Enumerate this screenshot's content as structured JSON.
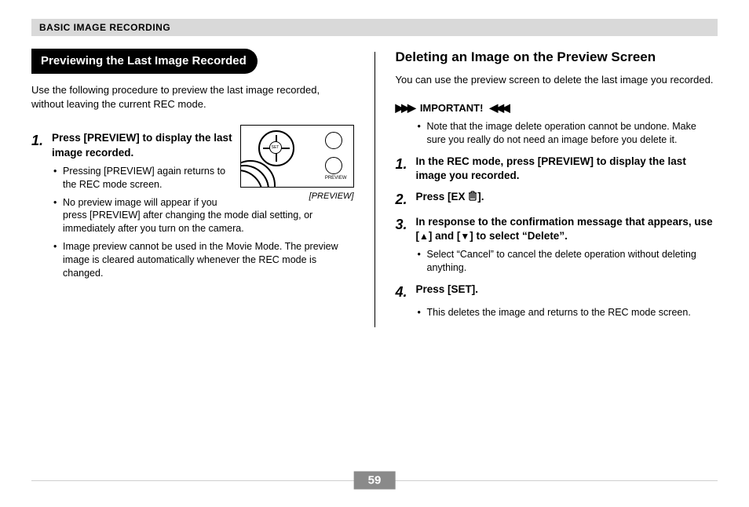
{
  "header": "BASIC IMAGE RECORDING",
  "page_number": "59",
  "left": {
    "pill": "Previewing the Last Image Recorded",
    "intro": "Use the following procedure to preview the last image recorded, without leaving the current REC mode.",
    "fig_caption": "[PREVIEW]",
    "fig_set_label": "SET",
    "fig_preview_label": "PREVIEW",
    "step1_num": "1.",
    "step1_text": "Press [PREVIEW] to display the last image recorded.",
    "step1_bullets": [
      "Pressing [PREVIEW] again returns to the REC mode screen.",
      "No preview image will appear if you press [PREVIEW] after changing the mode dial setting, or immediately after you turn on the camera.",
      "Image preview cannot be used in the Movie Mode. The preview image is cleared automatically whenever the REC mode is changed."
    ]
  },
  "right": {
    "title": "Deleting an Image on the Preview Screen",
    "intro": "You can use the preview screen to delete the last image you recorded.",
    "important_label": "IMPORTANT!",
    "important_bullets": [
      "Note that the image delete operation cannot be undone. Make sure you really do not need an image before you delete it."
    ],
    "steps": [
      {
        "num": "1.",
        "text": "In the REC mode, press [PREVIEW] to display the last image you recorded."
      },
      {
        "num": "2.",
        "pre": "Press [EX ",
        "post": "]."
      },
      {
        "num": "3.",
        "pre": "In response to the confirmation message that appears, use [",
        "mid": "] and [",
        "post": "] to select “Delete”."
      },
      {
        "num": "4.",
        "text": "Press [SET]."
      }
    ],
    "step3_bullets": [
      "Select “Cancel” to cancel the delete operation without deleting anything."
    ],
    "step4_bullets": [
      "This deletes the image and returns to the REC mode screen."
    ]
  }
}
